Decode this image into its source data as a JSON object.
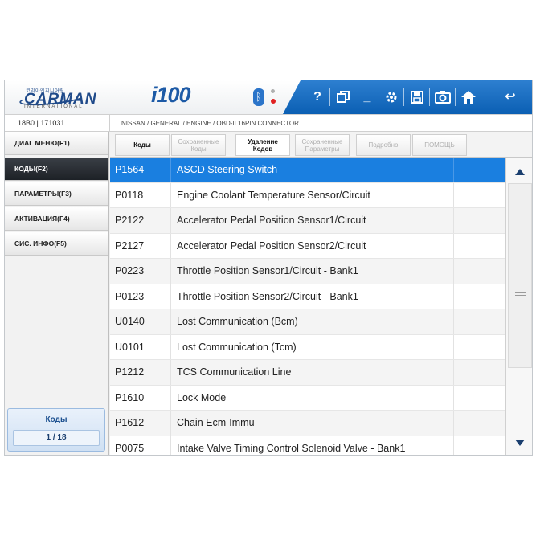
{
  "brand": {
    "logo_small": "코리아엔지니어링",
    "logo_main": "CARMAN",
    "logo_sub": "INTERNATIONAL",
    "model": "i100"
  },
  "toolbar": {
    "help_label": "?",
    "minimize_label": "_",
    "back_label": "↩",
    "icons": [
      "bluetooth-icon",
      "help-icon",
      "window-icon",
      "minimize-icon",
      "settings-icon",
      "save-icon",
      "camera-icon",
      "home-icon",
      "back-icon"
    ],
    "accent_color": "#0b5fb3"
  },
  "vehicle": {
    "id": "18B0  |   171031",
    "path": "NISSAN / GENERAL / ENGINE / OBD-II 16PIN CONNECTOR"
  },
  "sidebar": {
    "items": [
      {
        "label": "ДИАГ МЕНЮ(F1)",
        "active": false
      },
      {
        "label": "КОДЫ(F2)",
        "active": true
      },
      {
        "label": "ПАРАМЕТРЫ(F3)",
        "active": false
      },
      {
        "label": "АКТИВАЦИЯ(F4)",
        "active": false
      },
      {
        "label": "СИС. ИНФО(F5)",
        "active": false
      }
    ],
    "page_title": "Коды",
    "page_count": "1 / 18"
  },
  "tabs": [
    {
      "line1": "Коды",
      "line2": "",
      "state": "enabled"
    },
    {
      "line1": "Сохраненные",
      "line2": "Коды",
      "state": "disabled"
    },
    {
      "line1": "Удаление",
      "line2": "Кодов",
      "state": "selected"
    },
    {
      "line1": "Сохраненные",
      "line2": "Параметры",
      "state": "disabled"
    },
    {
      "line1": "Подробно",
      "line2": "",
      "state": "disabled"
    },
    {
      "line1": "ПОМОЩЬ",
      "line2": "",
      "state": "disabled"
    }
  ],
  "codes": [
    {
      "code": "P1564",
      "description": "ASCD Steering Switch",
      "selected": true
    },
    {
      "code": "P0118",
      "description": "Engine Coolant Temperature Sensor/Circuit",
      "selected": false
    },
    {
      "code": "P2122",
      "description": "Accelerator Pedal Position Sensor1/Circuit",
      "selected": false
    },
    {
      "code": "P2127",
      "description": "Accelerator Pedal Position Sensor2/Circuit",
      "selected": false
    },
    {
      "code": "P0223",
      "description": "Throttle Position Sensor1/Circuit - Bank1",
      "selected": false
    },
    {
      "code": "P0123",
      "description": "Throttle Position Sensor2/Circuit - Bank1",
      "selected": false
    },
    {
      "code": "U0140",
      "description": "Lost Communication (Bcm)",
      "selected": false
    },
    {
      "code": "U0101",
      "description": "Lost Communication (Tcm)",
      "selected": false
    },
    {
      "code": "P1212",
      "description": "TCS Communication Line",
      "selected": false
    },
    {
      "code": "P1610",
      "description": "Lock Mode",
      "selected": false
    },
    {
      "code": "P1612",
      "description": "Chain Ecm-Immu",
      "selected": false
    },
    {
      "code": "P0075",
      "description": "Intake Valve Timing Control Solenoid Valve - Bank1",
      "selected": false
    }
  ],
  "colors": {
    "selected_row": "#1a7fe0",
    "active_sidebar": "#1d2126"
  }
}
